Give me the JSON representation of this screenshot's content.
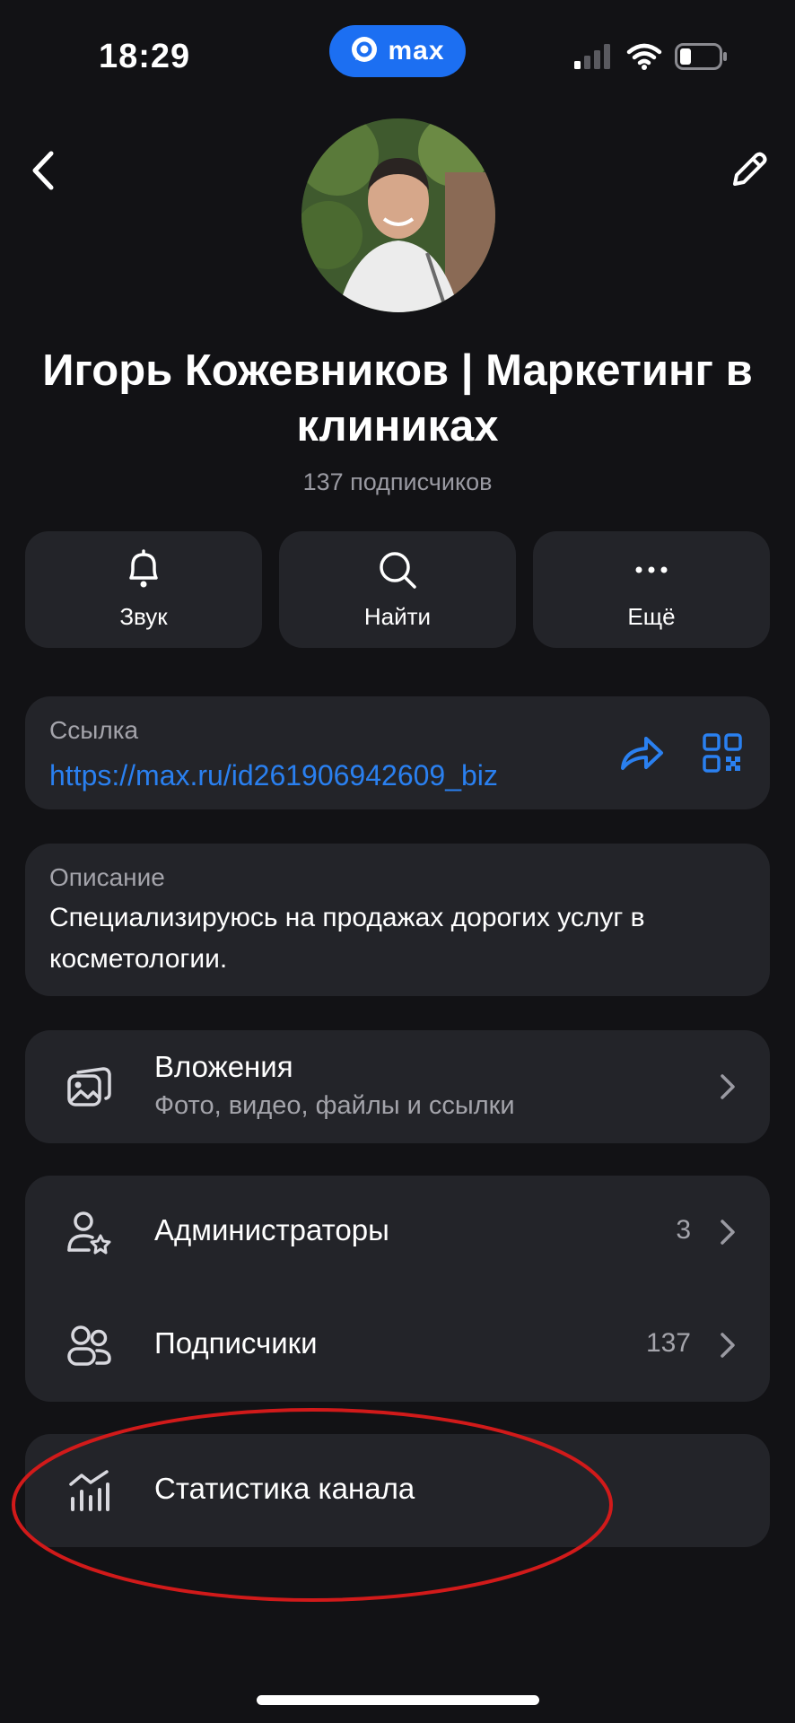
{
  "status_bar": {
    "time": "18:29",
    "app_badge": "max"
  },
  "header": {
    "back_icon": "chevron-left-icon",
    "edit_icon": "pencil-icon"
  },
  "profile": {
    "title": "Игорь Кожевников | Маркетинг в клиниках",
    "subscribers": "137 подписчиков"
  },
  "actions": [
    {
      "label": "Звук",
      "icon": "bell-icon"
    },
    {
      "label": "Найти",
      "icon": "search-icon"
    },
    {
      "label": "Ещё",
      "icon": "more-icon"
    }
  ],
  "link": {
    "caption": "Ссылка",
    "url": "https://max.ru/id261906942609_biz"
  },
  "description": {
    "caption": "Описание",
    "text": "Специализируюсь на продажах дорогих услуг в косметологии."
  },
  "attachments": {
    "title": "Вложения",
    "subtitle": "Фото, видео, файлы и ссылки"
  },
  "admins": {
    "title": "Администраторы",
    "count": "3"
  },
  "subscribers": {
    "title": "Подписчики",
    "count": "137"
  },
  "statistics": {
    "title": "Статистика канала"
  },
  "colors": {
    "accent": "#2a80f0",
    "card": "#232429",
    "background": "#121215",
    "highlight": "#d11a1a"
  }
}
